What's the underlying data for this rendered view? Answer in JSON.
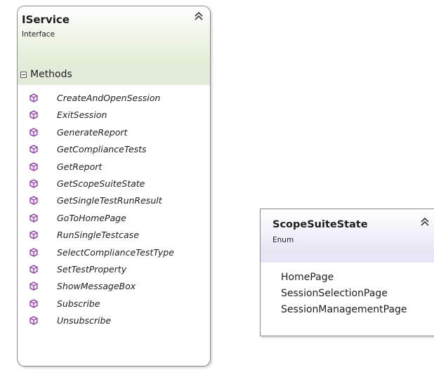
{
  "iservice": {
    "title": "IService",
    "stereotype": "Interface",
    "section_label": "Methods",
    "methods": [
      "CreateAndOpenSession",
      "ExitSession",
      "GenerateReport",
      "GetComplianceTests",
      "GetReport",
      "GetScopeSuiteState",
      "GetSingleTestRunResult",
      "GoToHomePage",
      "RunSingleTestcase",
      "SelectComplianceTestType",
      "SetTestProperty",
      "ShowMessageBox",
      "Subscribe",
      "Unsubscribe"
    ],
    "method_icon": "method-cube-icon",
    "collapse_icon": "double-chevron-up-icon",
    "colors": {
      "header": "#e2ecd6",
      "section": "#e3ebdb",
      "method_icon": "#8a3fa0"
    }
  },
  "scope_suite_state": {
    "title": "ScopeSuiteState",
    "stereotype": "Enum",
    "values": [
      "HomePage",
      "SessionSelectionPage",
      "SessionManagementPage"
    ],
    "collapse_icon": "double-chevron-up-icon",
    "colors": {
      "header": "#e8e5f4"
    }
  }
}
